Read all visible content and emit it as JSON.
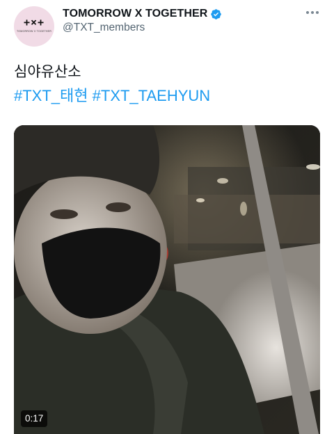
{
  "account": {
    "avatar_text": "+×+",
    "avatar_subtext": "TOMORROW X TOGETHER",
    "display_name": "TOMORROW X TOGETHER",
    "handle": "@TXT_members",
    "verified": true
  },
  "tweet": {
    "text": "심야유산소",
    "hashtags": [
      "#TXT_태현",
      "#TXT_TAEHYUN"
    ]
  },
  "media": {
    "type": "video",
    "duration": "0:17"
  },
  "colors": {
    "link": "#1d9bf0",
    "verified": "#1d9bf0",
    "secondary_text": "#536471",
    "avatar_bg": "#f1dbe6"
  }
}
